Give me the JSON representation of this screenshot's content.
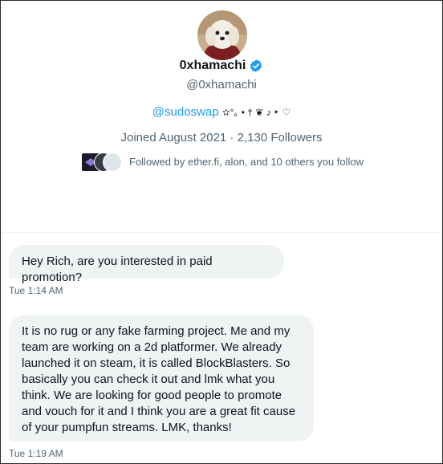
{
  "profile": {
    "display_name": "0xhamachi",
    "handle": "@0xhamachi",
    "bio_mention": "@sudoswap",
    "bio_rest": "✫°｡ • † ❦ ♪ ‣ ♡",
    "joined": "Joined August 2021",
    "separator": " · ",
    "followers": "2,130 Followers",
    "followed_by": "Followed by ether.fi, alon, and 10 others you follow",
    "icons": {
      "verified": "verified-badge-icon",
      "avatar": "dog-avatar"
    }
  },
  "colors": {
    "accent": "#1d9bf0",
    "bubble_bg": "#eff3f4",
    "secondary_text": "#536471"
  },
  "messages": [
    {
      "text": "Hey Rich, are you interested in paid promotion?",
      "time": "Tue 1:14 AM"
    },
    {
      "text": "It is no rug or any fake farming project. Me and my\nteam are working on a 2d platformer. We already\nlaunched it on steam, it is  called BlockBlasters. So\nbasically you can check it out and lmk what you\nthink. We are looking for good people to promote\nand vouch for it and I think you are a great fit cause\nof your pumpfun streams. LMK, thanks!",
      "time": "Tue 1:19 AM"
    }
  ]
}
